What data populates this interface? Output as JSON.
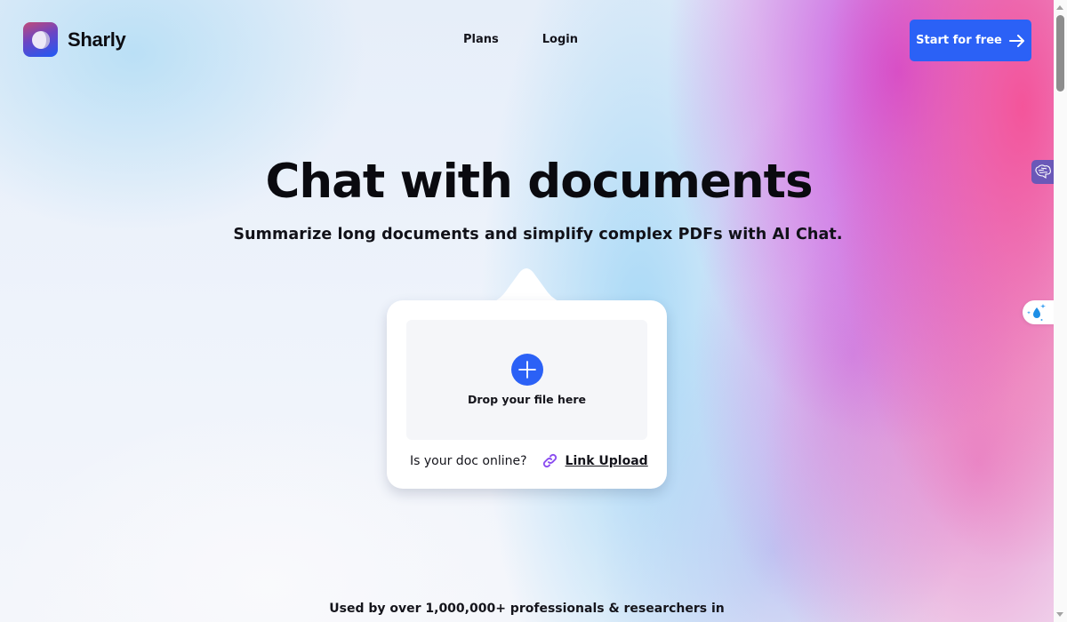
{
  "header": {
    "brand": "Sharly",
    "nav": [
      {
        "label": "Plans"
      },
      {
        "label": "Login"
      }
    ],
    "cta_label": "Start for free",
    "cta_icon": "arrow-right-icon"
  },
  "hero": {
    "title": "Chat with documents",
    "subtitle": "Summarize long documents and simplify complex PDFs with AI Chat."
  },
  "upload": {
    "drop_label": "Drop your file here",
    "drop_icon": "plus-icon",
    "online_question": "Is your doc online?",
    "link_icon": "link-icon",
    "link_upload_label": "Link Upload"
  },
  "social_proof": {
    "text": "Used by over 1,000,000+ professionals & researchers in"
  },
  "side_widgets": [
    {
      "icon": "brain-icon"
    },
    {
      "icon": "water-drop-sparkle-icon"
    }
  ],
  "colors": {
    "accent": "#2b61f6",
    "link_icon": "#8a4cf0",
    "brain_widget": "#6a58b8",
    "drop_icon": "#1e8fe6"
  }
}
